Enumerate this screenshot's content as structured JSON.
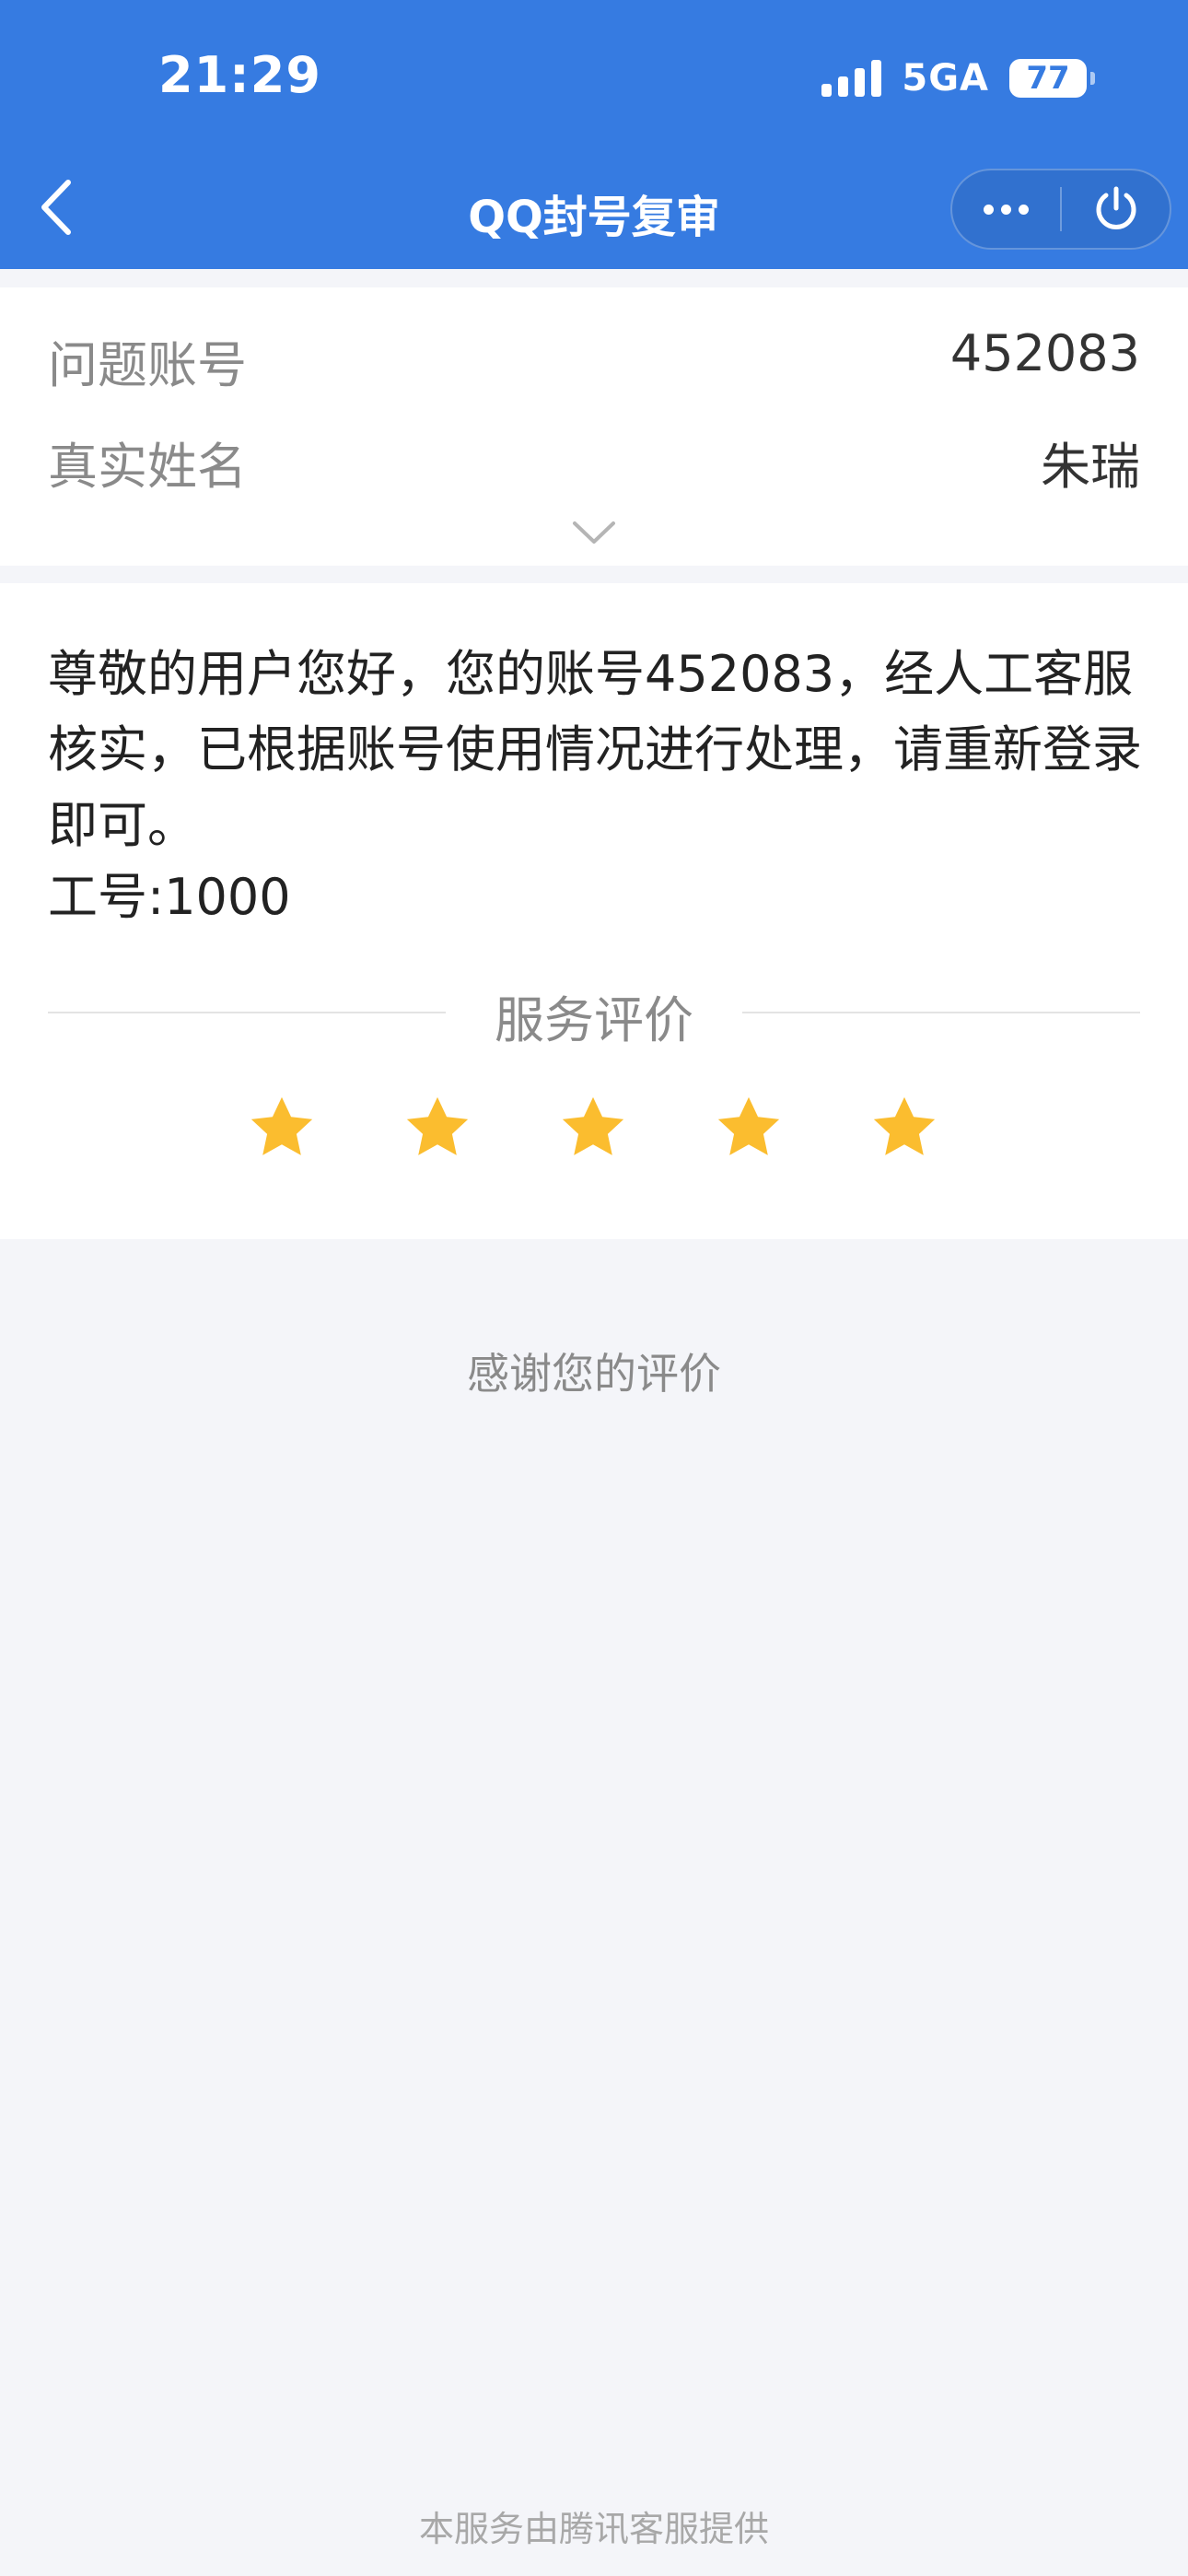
{
  "status_bar": {
    "time": "21:29",
    "network": "5GA",
    "battery": "77"
  },
  "nav": {
    "title": "QQ封号复审",
    "back_icon": "chevron-left-icon",
    "more_icon": "more-dots-icon",
    "power_icon": "power-icon"
  },
  "info": {
    "rows": [
      {
        "label": "问题账号",
        "value": "452083"
      },
      {
        "label": "真实姓名",
        "value": "朱瑞"
      }
    ],
    "expand_icon": "chevron-down-icon"
  },
  "message": {
    "text": "尊敬的用户您好，您的账号452083，经人工客服核实，已根据账号使用情况进行处理，请重新登录即可。",
    "work_id": "工号:1000"
  },
  "rating": {
    "title": "服务评价",
    "stars_max": 5,
    "stars_value": 5,
    "star_color": "#fbbd2f"
  },
  "thanks": "感谢您的评价",
  "footer": "本服务由腾讯客服提供",
  "colors": {
    "header_bg": "#367be1",
    "page_bg": "#f4f5f9"
  }
}
